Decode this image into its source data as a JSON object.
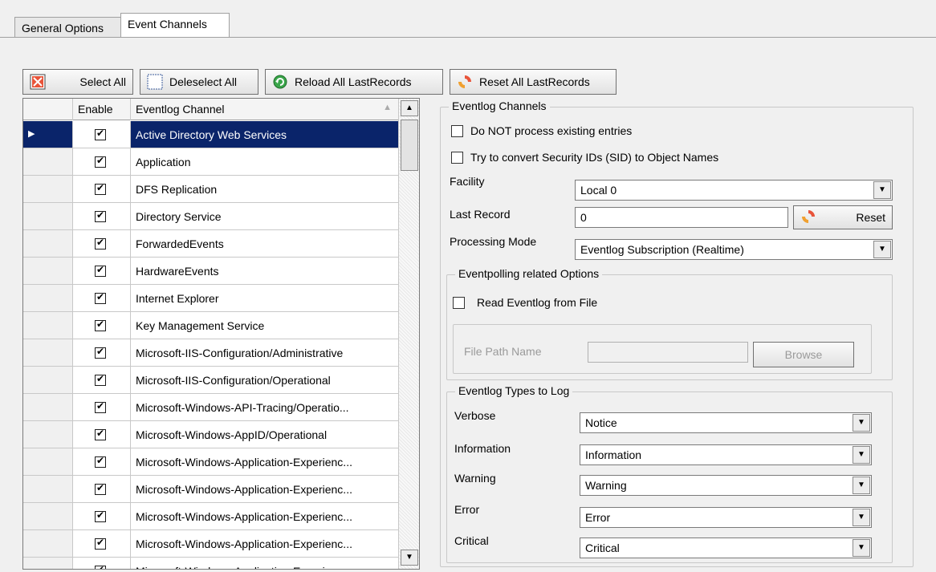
{
  "tabs": [
    "General Options",
    "Event Channels"
  ],
  "toolbar": {
    "select_all": "Select All",
    "deselect_all": "Deleselect All",
    "reload": "Reload All LastRecords",
    "reset": "Reset All LastRecords"
  },
  "grid": {
    "col_enable": "Enable",
    "col_channel": "Eventlog Channel",
    "rows": [
      "Active Directory Web Services",
      "Application",
      "DFS Replication",
      "Directory Service",
      "ForwardedEvents",
      "HardwareEvents",
      "Internet Explorer",
      "Key Management Service",
      "Microsoft-IIS-Configuration/Administrative",
      "Microsoft-IIS-Configuration/Operational",
      "Microsoft-Windows-API-Tracing/Operatio...",
      "Microsoft-Windows-AppID/Operational",
      "Microsoft-Windows-Application-Experienc...",
      "Microsoft-Windows-Application-Experienc...",
      "Microsoft-Windows-Application-Experienc...",
      "Microsoft-Windows-Application-Experienc...",
      "Microsoft-Windows-Application-Experienc..."
    ]
  },
  "panel": {
    "group_title": "Eventlog Channels",
    "no_process": "Do NOT process existing entries",
    "convert_sid": "Try to convert Security IDs (SID) to Object Names",
    "facility_label": "Facility",
    "facility_value": "Local 0",
    "last_record_label": "Last Record",
    "last_record_value": "0",
    "reset_btn": "Reset",
    "processing_label": "Processing Mode",
    "processing_value": "Eventlog Subscription (Realtime)",
    "polling_title": "Eventpolling related Options",
    "read_file": "Read Eventlog from File",
    "file_path_label": "File  Path Name",
    "browse_btn": "Browse",
    "types_title": "Eventlog Types to Log",
    "types": [
      {
        "label": "Verbose",
        "value": "Notice"
      },
      {
        "label": "Information",
        "value": "Information"
      },
      {
        "label": "Warning",
        "value": "Warning"
      },
      {
        "label": "Error",
        "value": "Error"
      },
      {
        "label": "Critical",
        "value": "Critical"
      }
    ]
  }
}
